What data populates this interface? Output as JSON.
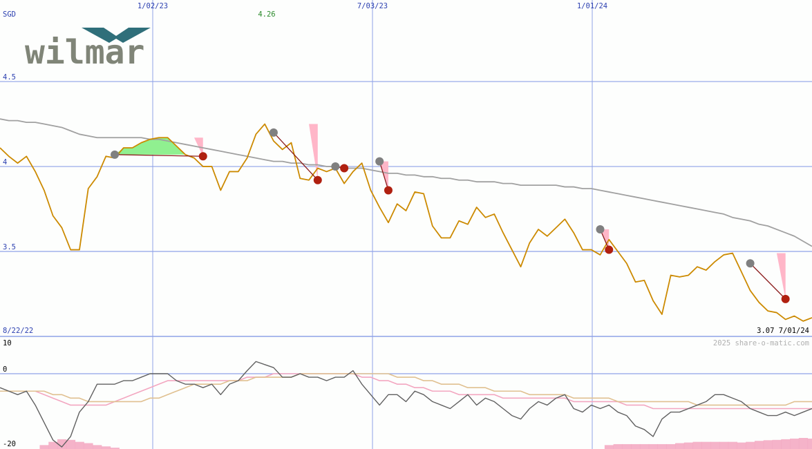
{
  "logo": {
    "text": "wilmar",
    "color": "#808578",
    "mark_color": "#2f6f7a"
  },
  "colors": {
    "grid": "#8fa2e8",
    "axis_text": "#2b3fb0",
    "price": "#cc8a00",
    "ma_long": "#a0a0a0",
    "osc": "#606060",
    "signal_pink": "#f3a6c0",
    "signal_tan": "#e0c090",
    "gain_fill": "#90f090",
    "loss_fill": "#ffb6c8",
    "entry_marker": "#808080",
    "exit_marker": "#b02010",
    "trade_line": "#8a1a1a",
    "high_label": "#2a8a2a",
    "watermark": "#b0b0b0"
  },
  "header": {
    "currency": "SGD",
    "high_label": "4.26"
  },
  "footer": {
    "start_date": "8/22/22",
    "last_price": "3.07",
    "end_date": "7/01/24",
    "watermark": "2025 share-o-matic.com"
  },
  "chart_data": [
    {
      "type": "line",
      "x_dates": [
        "1/02/23",
        "7/03/23",
        "1/01/24"
      ],
      "y_ticks": [
        "4.5",
        "4",
        "3.5"
      ],
      "ylim": [
        3.0,
        4.98
      ],
      "series": [
        {
          "values": [
            4.11,
            4.06,
            4.02,
            4.06,
            3.97,
            3.86,
            3.71,
            3.64,
            3.51,
            3.51,
            3.87,
            3.94,
            4.06,
            4.05,
            4.11,
            4.11,
            4.14,
            4.16,
            4.17,
            4.17,
            4.12,
            4.07,
            4.05,
            4.0,
            4.0,
            3.86,
            3.97,
            3.97,
            4.05,
            4.19,
            4.25,
            4.15,
            4.1,
            4.14,
            3.93,
            3.92,
            3.99,
            3.97,
            3.99,
            3.9,
            3.97,
            4.02,
            3.86,
            3.76,
            3.67,
            3.78,
            3.74,
            3.85,
            3.84,
            3.65,
            3.58,
            3.58,
            3.68,
            3.66,
            3.76,
            3.7,
            3.72,
            3.61,
            3.51,
            3.41,
            3.55,
            3.63,
            3.59,
            3.64,
            3.69,
            3.61,
            3.51,
            3.51,
            3.48,
            3.57,
            3.5,
            3.43,
            3.32,
            3.33,
            3.21,
            3.13,
            3.36,
            3.35,
            3.36,
            3.41,
            3.39,
            3.44,
            3.48,
            3.49,
            3.38,
            3.27,
            3.2,
            3.15,
            3.14,
            3.1,
            3.12,
            3.09,
            3.11
          ]
        },
        {
          "values": [
            4.28,
            4.27,
            4.27,
            4.26,
            4.26,
            4.25,
            4.24,
            4.23,
            4.21,
            4.19,
            4.18,
            4.17,
            4.17,
            4.17,
            4.17,
            4.17,
            4.17,
            4.16,
            4.16,
            4.15,
            4.14,
            4.13,
            4.12,
            4.11,
            4.1,
            4.09,
            4.08,
            4.07,
            4.06,
            4.05,
            4.04,
            4.03,
            4.03,
            4.02,
            4.02,
            4.01,
            4.01,
            4.0,
            4.0,
            3.99,
            3.99,
            3.99,
            3.98,
            3.97,
            3.96,
            3.96,
            3.95,
            3.95,
            3.94,
            3.94,
            3.93,
            3.93,
            3.92,
            3.92,
            3.91,
            3.91,
            3.91,
            3.9,
            3.9,
            3.89,
            3.89,
            3.89,
            3.89,
            3.89,
            3.88,
            3.88,
            3.87,
            3.87,
            3.86,
            3.85,
            3.84,
            3.83,
            3.82,
            3.81,
            3.8,
            3.79,
            3.78,
            3.77,
            3.76,
            3.75,
            3.74,
            3.73,
            3.72,
            3.7,
            3.69,
            3.68,
            3.66,
            3.65,
            3.63,
            3.61,
            3.59,
            3.56,
            3.53
          ]
        }
      ],
      "trades": [
        {
          "entry_i": 13,
          "exit_i": 23,
          "entry_y": 4.07,
          "exit_y": 4.06,
          "peak_y": 4.17
        },
        {
          "entry_i": 31,
          "exit_i": 36,
          "entry_y": 4.2,
          "exit_y": 3.92,
          "peak_y": 4.25
        },
        {
          "entry_i": 38,
          "exit_i": 39,
          "entry_y": 4.0,
          "exit_y": 3.99,
          "peak_y": 4.0
        },
        {
          "entry_i": 43,
          "exit_i": 44,
          "entry_y": 4.03,
          "exit_y": 3.86,
          "peak_y": 4.03
        },
        {
          "entry_i": 68,
          "exit_i": 69,
          "entry_y": 3.63,
          "exit_y": 3.51,
          "peak_y": 3.63
        },
        {
          "entry_i": 85,
          "exit_i": 89,
          "entry_y": 3.43,
          "exit_y": 3.22,
          "peak_y": 3.49
        }
      ]
    },
    {
      "type": "line",
      "y_ticks": [
        "10",
        "0",
        "-20"
      ],
      "ylim": [
        -20,
        10
      ],
      "series": [
        {
          "values": [
            -4,
            -5,
            -6,
            -5,
            -9,
            -14,
            -19,
            -21,
            -18,
            -11,
            -8,
            -3,
            -3,
            -3,
            -2,
            -2,
            -1,
            0,
            0,
            0,
            -2,
            -3,
            -3,
            -4,
            -3,
            -6,
            -3,
            -2,
            1,
            4,
            3,
            2,
            -1,
            -1,
            0,
            -1,
            -1,
            -2,
            -1,
            -1,
            1,
            -3,
            -6,
            -9,
            -6,
            -6,
            -8,
            -5,
            -6,
            -8,
            -9,
            -10,
            -8,
            -6,
            -9,
            -7,
            -8,
            -10,
            -12,
            -13,
            -10,
            -8,
            -9,
            -7,
            -6,
            -10,
            -11,
            -9,
            -10,
            -9,
            -11,
            -12,
            -15,
            -16,
            -18,
            -13,
            -11,
            -11,
            -10,
            -9,
            -8,
            -6,
            -6,
            -7,
            -8,
            -10,
            -11,
            -12,
            -12,
            -11,
            -12,
            -11,
            -10
          ]
        },
        {
          "values": [
            -5,
            -5,
            -5,
            -5,
            -5,
            -6,
            -7,
            -8,
            -9,
            -9,
            -9,
            -9,
            -9,
            -8,
            -7,
            -6,
            -5,
            -4,
            -3,
            -2,
            -2,
            -2,
            -2,
            -2,
            -2,
            -2,
            -2,
            -2,
            -1,
            -1,
            -1,
            0,
            0,
            0,
            0,
            0,
            0,
            0,
            0,
            0,
            0,
            -1,
            -1,
            -2,
            -2,
            -3,
            -3,
            -4,
            -4,
            -5,
            -5,
            -5,
            -6,
            -6,
            -6,
            -6,
            -6,
            -7,
            -7,
            -7,
            -7,
            -7,
            -7,
            -7,
            -7,
            -8,
            -8,
            -8,
            -8,
            -8,
            -8,
            -9,
            -9,
            -9,
            -10,
            -10,
            -10,
            -10,
            -10,
            -10,
            -10,
            -10,
            -10,
            -10,
            -10,
            -10,
            -10,
            -10,
            -10,
            -10,
            -10,
            -10,
            -10
          ]
        },
        {
          "values": [
            -5,
            -5,
            -5,
            -5,
            -5,
            -5,
            -6,
            -6,
            -7,
            -7,
            -8,
            -8,
            -8,
            -8,
            -8,
            -8,
            -8,
            -7,
            -7,
            -6,
            -5,
            -4,
            -3,
            -3,
            -3,
            -3,
            -2,
            -2,
            -2,
            -1,
            -1,
            -1,
            -1,
            -1,
            0,
            0,
            0,
            0,
            0,
            0,
            0,
            0,
            0,
            0,
            0,
            -1,
            -1,
            -1,
            -2,
            -2,
            -3,
            -3,
            -3,
            -4,
            -4,
            -4,
            -5,
            -5,
            -5,
            -5,
            -6,
            -6,
            -6,
            -6,
            -6,
            -7,
            -7,
            -7,
            -7,
            -7,
            -8,
            -8,
            -8,
            -8,
            -8,
            -8,
            -8,
            -8,
            -8,
            -9,
            -9,
            -9,
            -9,
            -9,
            -9,
            -9,
            -9,
            -9,
            -9,
            -9,
            -8,
            -8,
            -8
          ]
        }
      ],
      "histogram": [
        0,
        0,
        0,
        0,
        0,
        1.2,
        2.2,
        3.0,
        2.8,
        2.2,
        1.8,
        1.2,
        0.8,
        0.4,
        0,
        0,
        0,
        0,
        0,
        0,
        0,
        0,
        0,
        0,
        0,
        0,
        0,
        0,
        0,
        0,
        0,
        0,
        0,
        0,
        0,
        0,
        0,
        0,
        0,
        0,
        0,
        0,
        0,
        0,
        0,
        0,
        0,
        0,
        0,
        0,
        0,
        0,
        0,
        0,
        0,
        0,
        0,
        0,
        0,
        0,
        0,
        0,
        0,
        0,
        0,
        0,
        0,
        0,
        0,
        1.2,
        1.5,
        1.5,
        1.5,
        1.5,
        1.5,
        1.5,
        1.5,
        1.8,
        2.0,
        2.2,
        2.2,
        2.2,
        2.2,
        2.2,
        2.0,
        2.2,
        2.5,
        2.7,
        2.8,
        3.0,
        3.2,
        3.4,
        3.2
      ]
    }
  ]
}
